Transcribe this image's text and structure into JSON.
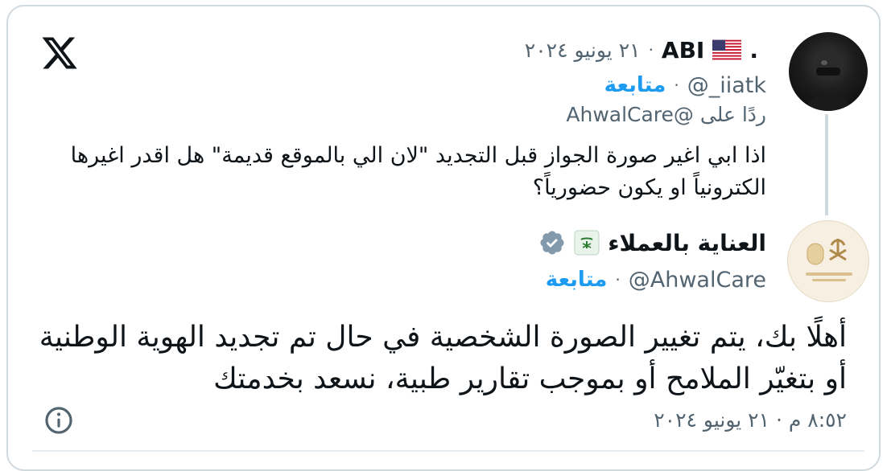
{
  "reply_tweet": {
    "author_name": "ABI",
    "author_name_suffix": ".",
    "date": "٢١ يونيو ٢٠٢٤",
    "handle": "@_iiatk",
    "follow_label": "متابعة",
    "reply_to": "ردًا على @AhwalCare",
    "text": "اذا ابي اغير صورة الجواز قبل التجديد \"لان الي بالموقع قديمة\" هل اقدر اغيرها الكترونياً او يكون حضورياً؟"
  },
  "main_tweet": {
    "author_name": "العناية بالعملاء",
    "handle": "@AhwalCare",
    "follow_label": "متابعة",
    "text": "أهلًا بك، يتم تغيير الصورة الشخصية في حال تم تجديد الهوية الوطنية أو بتغيّر الملامح أو بموجب تقارير طبية، نسعد بخدمتك",
    "timestamp": "٨:٥٢ م · ٢١ يونيو ٢٠٢٤"
  },
  "separator": "·",
  "icons": {
    "platform": "x-logo-icon",
    "flag": "us-flag-icon",
    "verified": "verified-badge-icon",
    "org_flag": "saudi-flag-icon",
    "info": "info-icon"
  },
  "colors": {
    "link_blue": "#1d9bf0",
    "muted": "#536471",
    "text": "#0f1419",
    "border": "#cfd9de",
    "verified_gray": "#829aab"
  }
}
